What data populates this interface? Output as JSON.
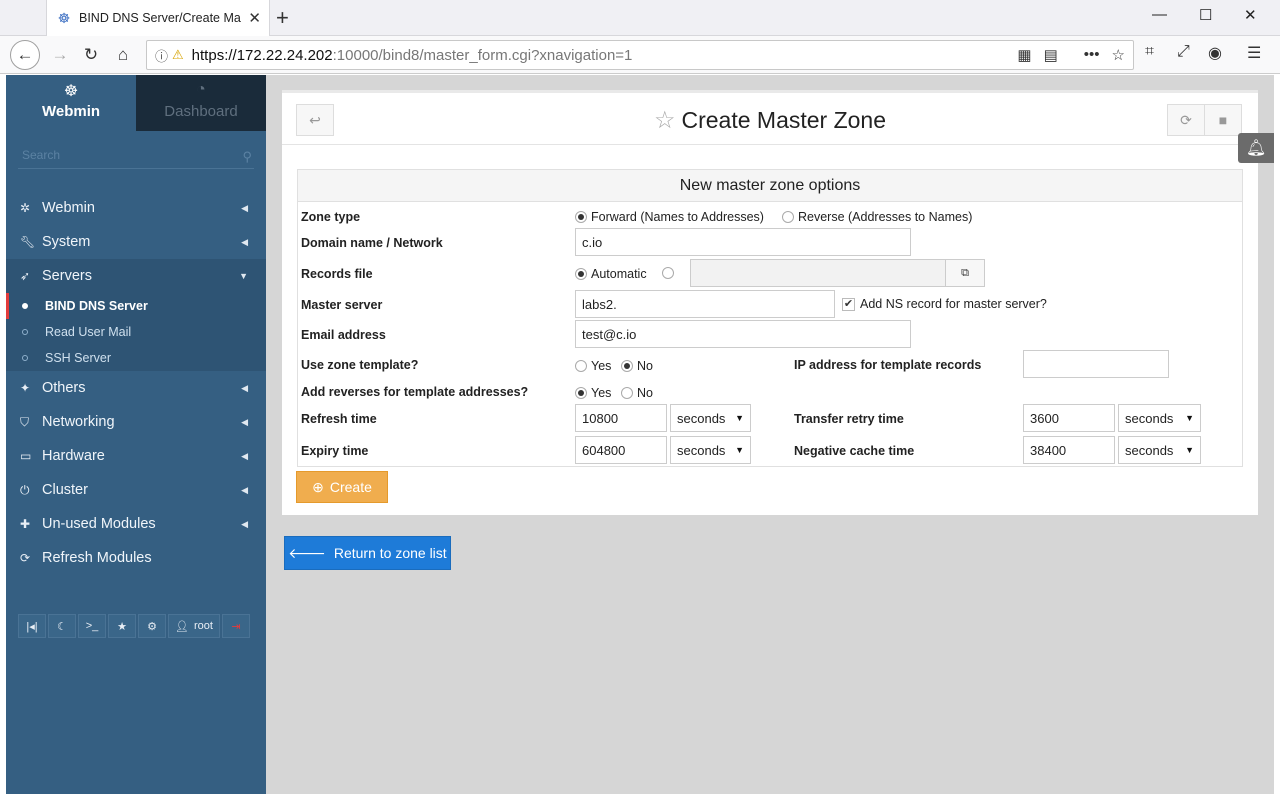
{
  "browser": {
    "tab_title": "BIND DNS Server/Create Ma",
    "url_host": "https://172.22.24.202",
    "url_rest": ":10000/bind8/master_form.cgi?xnavigation=1"
  },
  "sidebar": {
    "webmin_label": "Webmin",
    "dashboard_label": "Dashboard",
    "search_placeholder": "Search",
    "items": [
      {
        "label": "Webmin"
      },
      {
        "label": "System"
      },
      {
        "label": "Servers"
      },
      {
        "label": "Others"
      },
      {
        "label": "Networking"
      },
      {
        "label": "Hardware"
      },
      {
        "label": "Cluster"
      },
      {
        "label": "Un-used Modules"
      },
      {
        "label": "Refresh Modules"
      }
    ],
    "subitems": [
      {
        "label": "BIND DNS Server"
      },
      {
        "label": "Read User Mail"
      },
      {
        "label": "SSH Server"
      }
    ],
    "user": "root"
  },
  "page": {
    "title": "Create Master Zone",
    "section_title": "New master zone options"
  },
  "form": {
    "zone_type_label": "Zone type",
    "zone_type_forward": "Forward (Names to Addresses)",
    "zone_type_reverse": "Reverse (Addresses to Names)",
    "domain_label": "Domain name / Network",
    "domain_value": "c.io",
    "records_label": "Records file",
    "records_automatic": "Automatic",
    "master_label": "Master server",
    "master_value": "labs2.",
    "add_ns_label": "Add NS record for master server?",
    "email_label": "Email address",
    "email_value": "test@c.io",
    "template_label": "Use zone template?",
    "yes": "Yes",
    "no": "No",
    "ip_template_label": "IP address for template records",
    "reverses_label": "Add reverses for template addresses?",
    "refresh_label": "Refresh time",
    "refresh_value": "10800",
    "refresh_unit": "seconds",
    "retry_label": "Transfer retry time",
    "retry_value": "3600",
    "retry_unit": "seconds",
    "expiry_label": "Expiry time",
    "expiry_value": "604800",
    "expiry_unit": "seconds",
    "negcache_label": "Negative cache time",
    "negcache_value": "38400",
    "negcache_unit": "seconds"
  },
  "buttons": {
    "create": "Create",
    "return": "Return to zone list"
  }
}
